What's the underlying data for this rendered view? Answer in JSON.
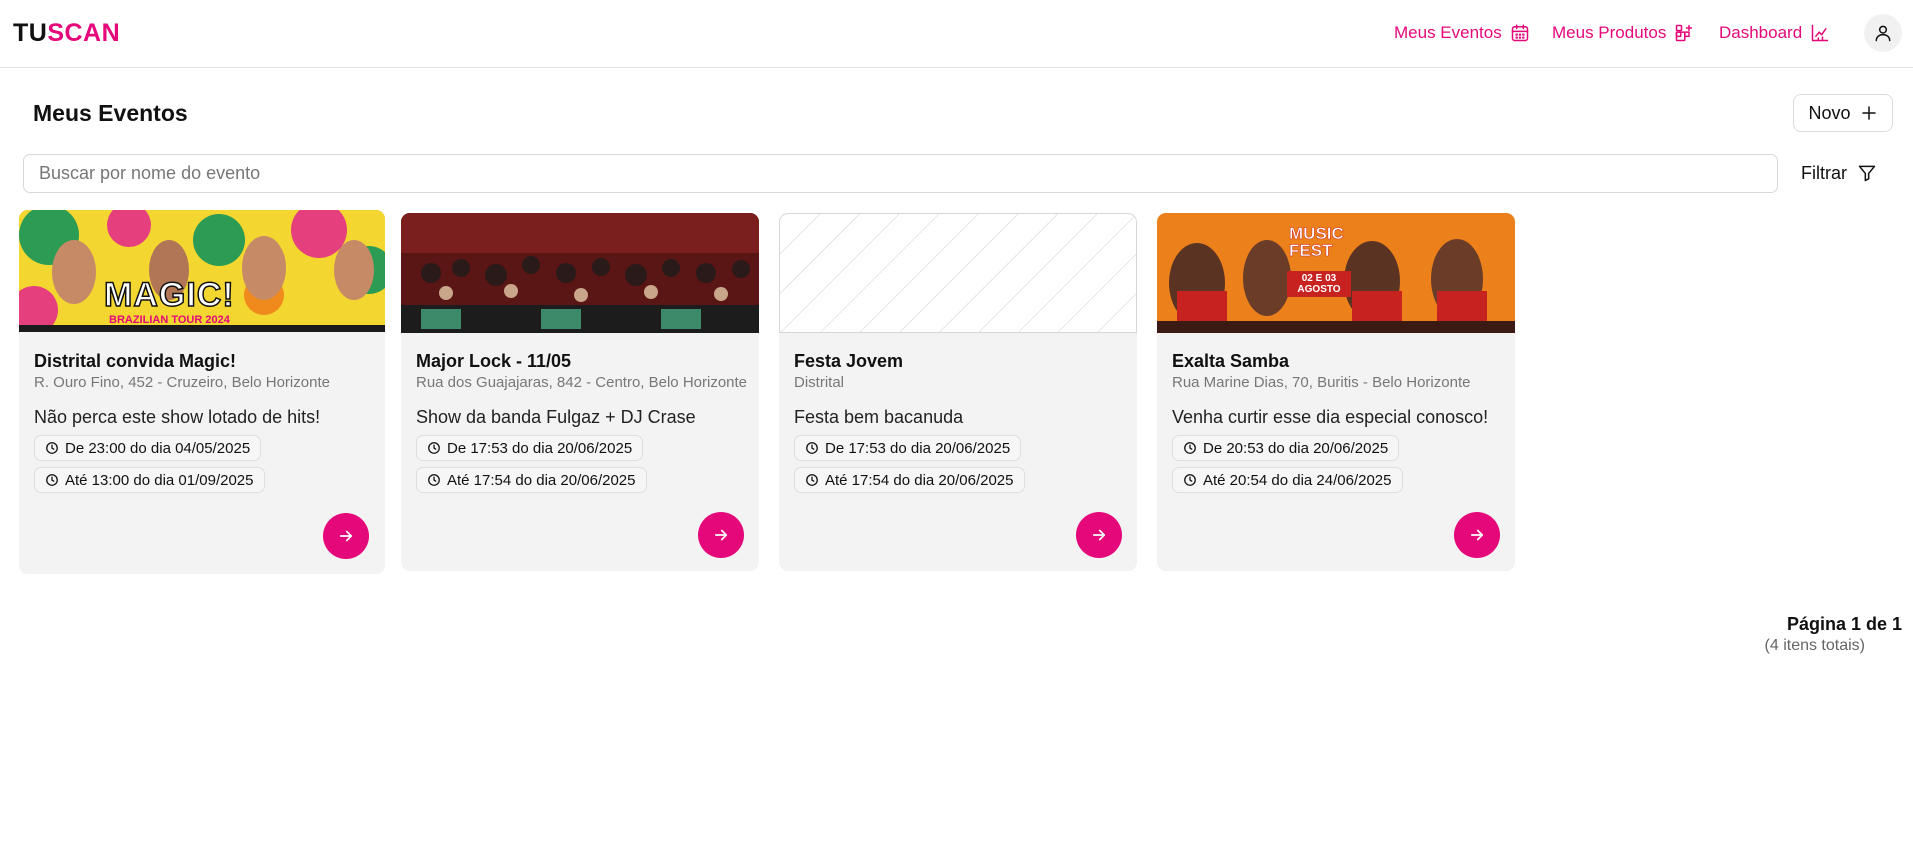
{
  "brand": {
    "part1": "TU",
    "part2": "SCAN",
    "accent": "#e4087a"
  },
  "nav": {
    "eventos": {
      "label": "Meus Eventos",
      "icon": "calendar-icon"
    },
    "produtos": {
      "label": "Meus Produtos",
      "icon": "grid-plus-icon"
    },
    "dashboard": {
      "label": "Dashboard",
      "icon": "chart-icon"
    },
    "profile_icon": "user-icon"
  },
  "page": {
    "title": "Meus Eventos",
    "new_label": "Novo"
  },
  "search": {
    "placeholder": "Buscar por nome do evento",
    "value": ""
  },
  "filter": {
    "label": "Filtrar"
  },
  "events": [
    {
      "title": "Distrital convida Magic!",
      "location": "R. Ouro Fino, 452 - Cruzeiro, Belo Horizonte",
      "description": "Não perca este show lotado de hits!",
      "start": "De 23:00 do dia 04/05/2025",
      "end": "Até 13:00 do dia 01/09/2025",
      "image_text": "MAGIC!",
      "image_subtext": "BRAZILIAN TOUR 2024"
    },
    {
      "title": "Major Lock - 11/05",
      "location": "Rua dos Guajajaras, 842 - Centro, Belo Horizonte",
      "description": "Show da banda Fulgaz + DJ Crase",
      "start": "De 17:53 do dia 20/06/2025",
      "end": "Até 17:54 do dia 20/06/2025"
    },
    {
      "title": "Festa Jovem",
      "location": "Distrital",
      "description": "Festa bem bacanuda",
      "start": "De 17:53 do dia 20/06/2025",
      "end": "Até 17:54 do dia 20/06/2025"
    },
    {
      "title": "Exalta Samba",
      "location": "Rua Marine Dias, 70, Buritis - Belo Horizonte",
      "description": "Venha curtir esse dia especial conosco!",
      "start": "De 20:53 do dia 20/06/2025",
      "end": "Até 20:54 do dia 24/06/2025",
      "image_text": "MUSIC FEST",
      "image_subtext": "02 E 03 AGOSTO"
    }
  ],
  "pagination": {
    "label": "Página 1 de 1",
    "total": "(4 itens totais)"
  }
}
